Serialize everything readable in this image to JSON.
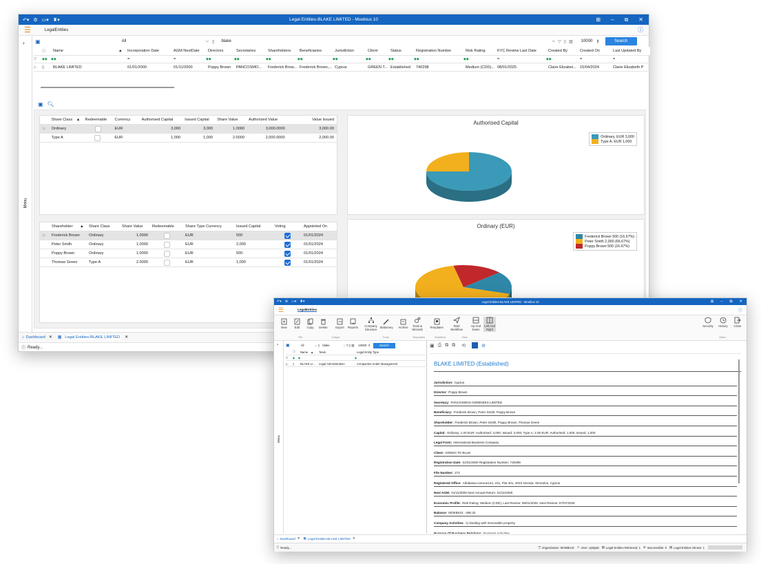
{
  "main": {
    "window_title": "Legal Entities-BLAKE LIMITED - Moebius 10",
    "breadcrumb": "LegalEntities",
    "menu_label": "Menu",
    "filter": {
      "scope": "All",
      "search_value": "blake",
      "count": "10000",
      "search_button": "Search"
    },
    "table": {
      "columns": [
        "Name",
        "Incorporation Date",
        "AGM NextDate",
        "Directors",
        "Secretaries",
        "Shareholders",
        "Beneficiaries",
        "Jurisdiction",
        "Client",
        "Status",
        "Registration Number",
        "Risk Rating",
        "KYC Review Last Date",
        "Created By",
        "Created On",
        "Last Updated By"
      ],
      "filter_ops": [
        "=",
        "=",
        "=",
        "=",
        "="
      ],
      "row": [
        "BLAKE LIMITED",
        "01/01/2000",
        "01/11/2000",
        "Poppy Brown",
        "PANCOSMO...",
        "Frederick Brow...",
        "Frederick Brown,...",
        "Cyprus",
        "GREEN T...",
        "Established",
        "740298",
        "Medium (CDD)...",
        "08/01/2025",
        "Claire Elizabet...",
        "15/04/2024",
        "Claire Elizabeth P"
      ]
    },
    "share_class": {
      "columns": [
        "Share Class",
        "Redeemable",
        "Currency",
        "Authorised Capital",
        "Issued Capital",
        "Share Value",
        "Authorized Value",
        "Value Issued"
      ],
      "rows": [
        [
          "Ordinary",
          "",
          "EUR",
          "3,000",
          "3,000",
          "1.0000",
          "3,000.0000",
          "3,000.00"
        ],
        [
          "Type A",
          "",
          "EUR",
          "1,000",
          "1,000",
          "2.0000",
          "2,000.0000",
          "2,000.00"
        ]
      ]
    },
    "shareholders": {
      "columns": [
        "Shareholder",
        "Share Class",
        "Share Value",
        "Redeemable",
        "Share Type Currency",
        "Issued Capital",
        "Voting",
        "Appointed On"
      ],
      "rows": [
        [
          "Frederick Brown",
          "Ordinary",
          "1.0000",
          "",
          "EUR",
          "500",
          "",
          "01/01/2024"
        ],
        [
          "Peter Smith",
          "Ordinary",
          "1.0000",
          "",
          "EUR",
          "2,000",
          "",
          "01/01/2024"
        ],
        [
          "Poppy Brown",
          "Ordinary",
          "1.0000",
          "",
          "EUR",
          "500",
          "",
          "01/01/2024"
        ],
        [
          "Thomas Green",
          "Type A",
          "2.0000",
          "",
          "EUR",
          "1,000",
          "",
          "01/01/2024"
        ]
      ]
    },
    "tabs": [
      "Dashboard",
      "Legal Entities-BLAKE LIMITED"
    ],
    "status": "Ready..."
  },
  "chart_data": [
    {
      "type": "pie",
      "title": "Authorised Capital",
      "categories": [
        "Ordinary, EUR 3,000",
        "Type A, EUR 1,000"
      ],
      "values": [
        3000,
        1000
      ],
      "colors": [
        "#3a9ab8",
        "#f2b01e"
      ],
      "legend": "top-right"
    },
    {
      "type": "pie",
      "title": "Ordinary (EUR)",
      "categories": [
        "Frederick Brown 500 (16.67%)",
        "Peter Smith 2,000 (66.67%)",
        "Poppy Brown 500 (16.67%)"
      ],
      "values": [
        500,
        2000,
        500
      ],
      "colors": [
        "#2f88a8",
        "#f2b01e",
        "#c0282c"
      ],
      "legend": "top-right"
    }
  ],
  "front": {
    "window_title": "Legal Entities-BLAKE LIMITED - Moebius 10",
    "breadcrumb": "LegalEntities",
    "ribbon": {
      "groups": [
        {
          "name": "File",
          "buttons": [
            "New",
            "Edit",
            "Copy",
            "Delete"
          ]
        },
        {
          "name": "Output",
          "buttons": [
            "Export",
            "Reports"
          ]
        },
        {
          "name": "Tools",
          "buttons": [
            "Company Structure",
            "Stationery",
            "Archive",
            "Tools & Wizards"
          ]
        },
        {
          "name": "Templates",
          "buttons": [
            "Templates"
          ]
        },
        {
          "name": "Workflow",
          "buttons": [
            "Start Workflow"
          ]
        },
        {
          "name": "View",
          "buttons": [
            "Up And Down",
            "Left And Right"
          ]
        },
        {
          "name": "Other",
          "buttons": [
            "Security",
            "History",
            "Close"
          ]
        }
      ]
    },
    "filter": {
      "scope": "All",
      "search_value": "blake",
      "count": "10000",
      "search_button": "Search"
    },
    "table": {
      "columns": [
        "Name",
        "Team",
        "Legal Entity Type"
      ],
      "row": [
        "BLAKE LIMITED",
        "Legal Administration",
        "Companies Under Management"
      ]
    },
    "doc": {
      "heading": "BLAKE LIMITED (Established)",
      "lines": [
        {
          "label": "Jurisdiction:",
          "value": "Cyprus"
        },
        {
          "label": "Director:",
          "value": "Poppy Brown"
        },
        {
          "label": "Secretary:",
          "value": "PANCOSMOS NOMINEES LIMITED"
        },
        {
          "label": "Beneficiary:",
          "value": "Frederick Brown, Peter Smith, Poppy Brown"
        },
        {
          "label": "Shareholder:",
          "value": "Frederick Brown, Peter Smith, Poppy Brown, Thomas Green"
        },
        {
          "label": "Capital:",
          "value": "Ordinary, 1.00 EUR: Authorised: 3,000, Issued: 3,000; Type A, 2.00 EUR: Authorised: 1,000, Issued: 1,000"
        },
        {
          "label": "Legal Form:",
          "value": "International Business Company"
        },
        {
          "label": "Client:",
          "value": "GREEN TO BLUE"
        },
        {
          "label": "Registration Date:",
          "value": "01/01/2000 Registration Number: 740298"
        },
        {
          "label": "File Number:",
          "value": "272"
        },
        {
          "label": "Registered Office:",
          "value": "Athalassa Avenue144, 101, Flat 301, 2023 Nicosia, Strovolos, Cyprus"
        },
        {
          "label": "Next AGM:",
          "value": "01/11/2000 Next Annual Return: 01/11/2000"
        },
        {
          "label": "Economic Profile:",
          "value": "Risk Rating: Medium (CDD), Last Review: 08/01/2025, Next Review: 07/07/2025"
        },
        {
          "label": "Balance:",
          "value": "MOEBIUS: -490.32"
        },
        {
          "label": "Company Activities:",
          "value": "1) Dealing with immovable property"
        },
        {
          "label": "Purpose Of Business Relations:",
          "value": "Business Activities"
        }
      ]
    },
    "tabs": [
      "Dashboard",
      "Legal Entities-BLAKE LIMITED"
    ],
    "status": {
      "left": "Ready...",
      "organization": "Organization: MOEBIUS",
      "user": "User: cyldpatt",
      "retrieved": "Legal Entities Retrieved: 1",
      "inaccessible": "Inaccessible: 0",
      "shown": "Legal Entities Shown: 1"
    }
  }
}
